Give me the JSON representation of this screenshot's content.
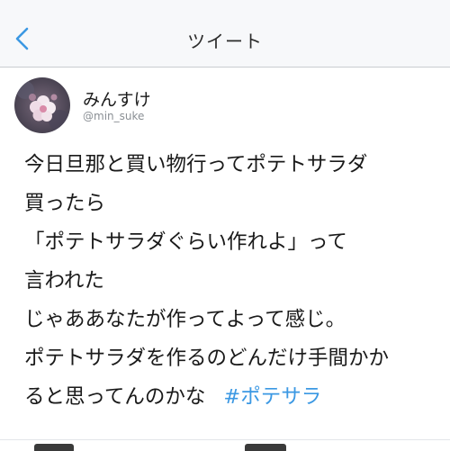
{
  "nav": {
    "title": "ツイート",
    "back_icon": "chevron-left-icon",
    "accent_color": "#3b98e3"
  },
  "tweet": {
    "display_name": "みんすけ",
    "handle": "@min_suke",
    "lines": [
      "今日旦那と買い物行ってポテトサラダ",
      "買ったら",
      "「ポテトサラダぐらい作れよ」って",
      "言われた",
      "じゃああなたが作ってよって感じ。",
      "ポテトサラダを作るのどんだけ手間かか",
      "ると思ってんのかな"
    ],
    "hashtag": "#ポテサラ"
  }
}
